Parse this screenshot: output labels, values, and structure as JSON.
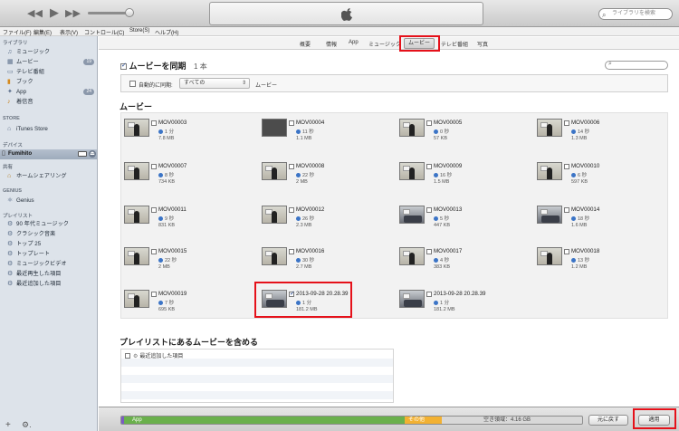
{
  "window": {
    "search_placeholder": "ライブラリを検索",
    "menu": [
      "ファイル(F)",
      "編集(E)",
      "表示(V)",
      "コントロール(C)",
      "Store(S)",
      "ヘルプ(H)"
    ]
  },
  "sidebar": {
    "library_header": "ライブラリ",
    "library_items": [
      {
        "label": "ミュージック",
        "icon": "music-note-icon",
        "badge": ""
      },
      {
        "label": "ムービー",
        "icon": "film-icon",
        "badge": "19"
      },
      {
        "label": "テレビ番組",
        "icon": "tv-icon",
        "badge": ""
      },
      {
        "label": "ブック",
        "icon": "book-icon",
        "badge": ""
      },
      {
        "label": "App",
        "icon": "app-icon",
        "badge": "24"
      },
      {
        "label": "着信音",
        "icon": "bell-icon",
        "badge": ""
      }
    ],
    "store_header": "STORE",
    "store_item": "iTunes Store",
    "devices_header": "デバイス",
    "device_item": "Fumihito",
    "shared_header": "共有",
    "shared_item": "ホームシェアリング",
    "genius_header": "GENIUS",
    "genius_item": "Genius",
    "playlists_header": "プレイリスト",
    "playlists": [
      "90 年代ミュージック",
      "クラシック音楽",
      "トップ 25",
      "トップレート",
      "ミュージックビデオ",
      "最近再生した項目",
      "最近追加した項目"
    ]
  },
  "tabs": [
    "概要",
    "情報",
    "App",
    "ミュージック",
    "ムービー",
    "テレビ番組",
    "写真"
  ],
  "active_tab": "ムービー",
  "sync": {
    "label": "ムービーを同期",
    "count": "1 本",
    "checked": true,
    "auto_label": "自動的に同期:",
    "auto_value": "すべての",
    "auto_tail": "ムービー"
  },
  "movies_header": "ムービー",
  "movies": [
    {
      "title": "MOV00003",
      "duration": "1 分",
      "size": "7.8 MB",
      "thumb": "lecture",
      "checked": false
    },
    {
      "title": "MOV00004",
      "duration": "11 秒",
      "size": "1.1 MB",
      "thumb": "dark",
      "checked": false
    },
    {
      "title": "MOV00005",
      "duration": "0 秒",
      "size": "57 KB",
      "thumb": "lecture",
      "checked": false
    },
    {
      "title": "MOV00006",
      "duration": "14 秒",
      "size": "1.3 MB",
      "thumb": "lecture",
      "checked": false
    },
    {
      "title": "MOV00007",
      "duration": "8 秒",
      "size": "734 KB",
      "thumb": "lecture",
      "checked": false
    },
    {
      "title": "MOV00008",
      "duration": "22 秒",
      "size": "2 MB",
      "thumb": "lecture",
      "checked": false
    },
    {
      "title": "MOV00009",
      "duration": "16 秒",
      "size": "1.5 MB",
      "thumb": "lecture",
      "checked": false
    },
    {
      "title": "MOV00010",
      "duration": "6 秒",
      "size": "597 KB",
      "thumb": "lecture",
      "checked": false
    },
    {
      "title": "MOV00011",
      "duration": "9 秒",
      "size": "831 KB",
      "thumb": "lecture",
      "checked": false
    },
    {
      "title": "MOV00012",
      "duration": "26 秒",
      "size": "2.3 MB",
      "thumb": "lecture",
      "checked": false
    },
    {
      "title": "MOV00013",
      "duration": "5 秒",
      "size": "447 KB",
      "thumb": "room",
      "checked": false
    },
    {
      "title": "MOV00014",
      "duration": "18 秒",
      "size": "1.6 MB",
      "thumb": "room",
      "checked": false
    },
    {
      "title": "MOV00015",
      "duration": "22 秒",
      "size": "2 MB",
      "thumb": "lecture",
      "checked": false
    },
    {
      "title": "MOV00016",
      "duration": "30 秒",
      "size": "2.7 MB",
      "thumb": "lecture",
      "checked": false
    },
    {
      "title": "MOV00017",
      "duration": "4 秒",
      "size": "383 KB",
      "thumb": "lecture",
      "checked": false
    },
    {
      "title": "MOV00018",
      "duration": "13 秒",
      "size": "1.2 MB",
      "thumb": "lecture",
      "checked": false
    },
    {
      "title": "MOV00019",
      "duration": "7 秒",
      "size": "695 KB",
      "thumb": "lecture",
      "checked": false
    },
    {
      "title": "2013-09-28 20.28.39",
      "duration": "1 分",
      "size": "181.2 MB",
      "thumb": "room",
      "checked": true
    },
    {
      "title": "2013-09-28 20.28.39",
      "duration": "1 分",
      "size": "181.2 MB",
      "thumb": "room",
      "checked": false
    }
  ],
  "playlist_section": {
    "header": "プレイリストにあるムービーを含める",
    "item": "最近追加した項目"
  },
  "capacity": {
    "app_label": "App",
    "other_label": "その他",
    "free_label": "空き領域：4.16 GB",
    "app_fraction": 0.61,
    "other_fraction": 0.08,
    "colors": {
      "app": "#6ab04c",
      "other": "#f2b132",
      "music": "#7a5cc2"
    }
  },
  "buttons": {
    "revert": "元に戻す",
    "apply": "適用"
  },
  "annotation_color": "#e5111a"
}
